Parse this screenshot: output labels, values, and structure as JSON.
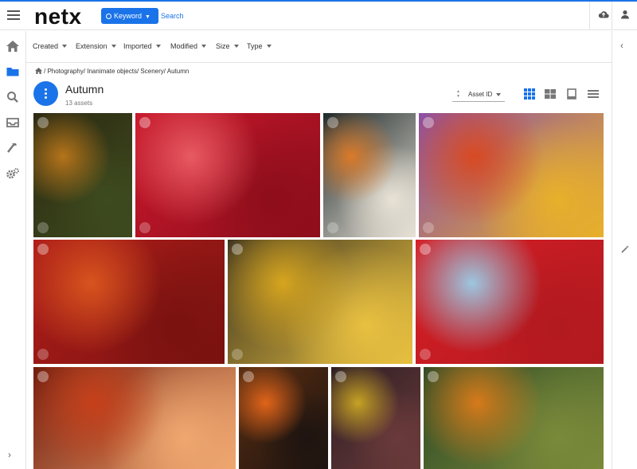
{
  "app": {
    "logo": "netx",
    "accent_color": "#1a73e8"
  },
  "search": {
    "mode_label": "Keyword",
    "placeholder": "Search"
  },
  "header_icons": [
    "menu-icon",
    "cloud-upload-icon",
    "user-icon"
  ],
  "sidebar": {
    "items": [
      "home-icon",
      "folder-icon",
      "search-icon",
      "inbox-icon",
      "hammer-icon",
      "settings-icon"
    ],
    "active": "folder-icon",
    "expand_glyph": "›"
  },
  "filters": [
    "Created",
    "Extension",
    "Imported",
    "Modified",
    "Size",
    "Type"
  ],
  "breadcrumb": {
    "text": "/ Photography/ Inanimate objects/ Scenery/ Autumn"
  },
  "collection": {
    "title": "Autumn",
    "count_label": "13 assets",
    "sort_label": "Asset ID",
    "view_modes": [
      "grid-view",
      "mosaic-view",
      "detail-view",
      "list-view"
    ],
    "active_view": "grid-view"
  },
  "right_rail": {
    "collapse_glyph": "‹",
    "tool_icon": "magic-wand-icon"
  },
  "thumbnails": [
    {
      "name": "autumn-maple-branch",
      "colors": [
        "#2d2a12",
        "#b5741a",
        "#3d4a1e"
      ]
    },
    {
      "name": "red-maple-leaves-closeup",
      "colors": [
        "#c8182b",
        "#e85a62",
        "#8e0e1c"
      ]
    },
    {
      "name": "pumpkin-shelves",
      "colors": [
        "#1f2a2c",
        "#d97a2a",
        "#e8e2d6"
      ]
    },
    {
      "name": "colorful-leaves-pile",
      "colors": [
        "#8a4fa8",
        "#d84a22",
        "#e8b02a"
      ]
    },
    {
      "name": "red-apples",
      "colors": [
        "#b01e1a",
        "#d8541e",
        "#7a1210"
      ]
    },
    {
      "name": "squirrel-yellow-leaves",
      "colors": [
        "#3d3420",
        "#d6a51f",
        "#e8c040"
      ]
    },
    {
      "name": "red-leaves-blue-sky",
      "colors": [
        "#d61e25",
        "#9cc6e0",
        "#b21a20"
      ]
    },
    {
      "name": "autumn-tree-sunlight",
      "colors": [
        "#6d1a0e",
        "#c6401a",
        "#f0a870"
      ]
    },
    {
      "name": "pumpkins-crate",
      "colors": [
        "#5a2e12",
        "#e0641a",
        "#1e1410"
      ]
    },
    {
      "name": "yellow-leaf-dark",
      "colors": [
        "#2d1e24",
        "#c6a224",
        "#6a3a3a"
      ]
    },
    {
      "name": "forest-aerial",
      "colors": [
        "#2e4a26",
        "#d67a1a",
        "#7a8a3a"
      ]
    }
  ]
}
